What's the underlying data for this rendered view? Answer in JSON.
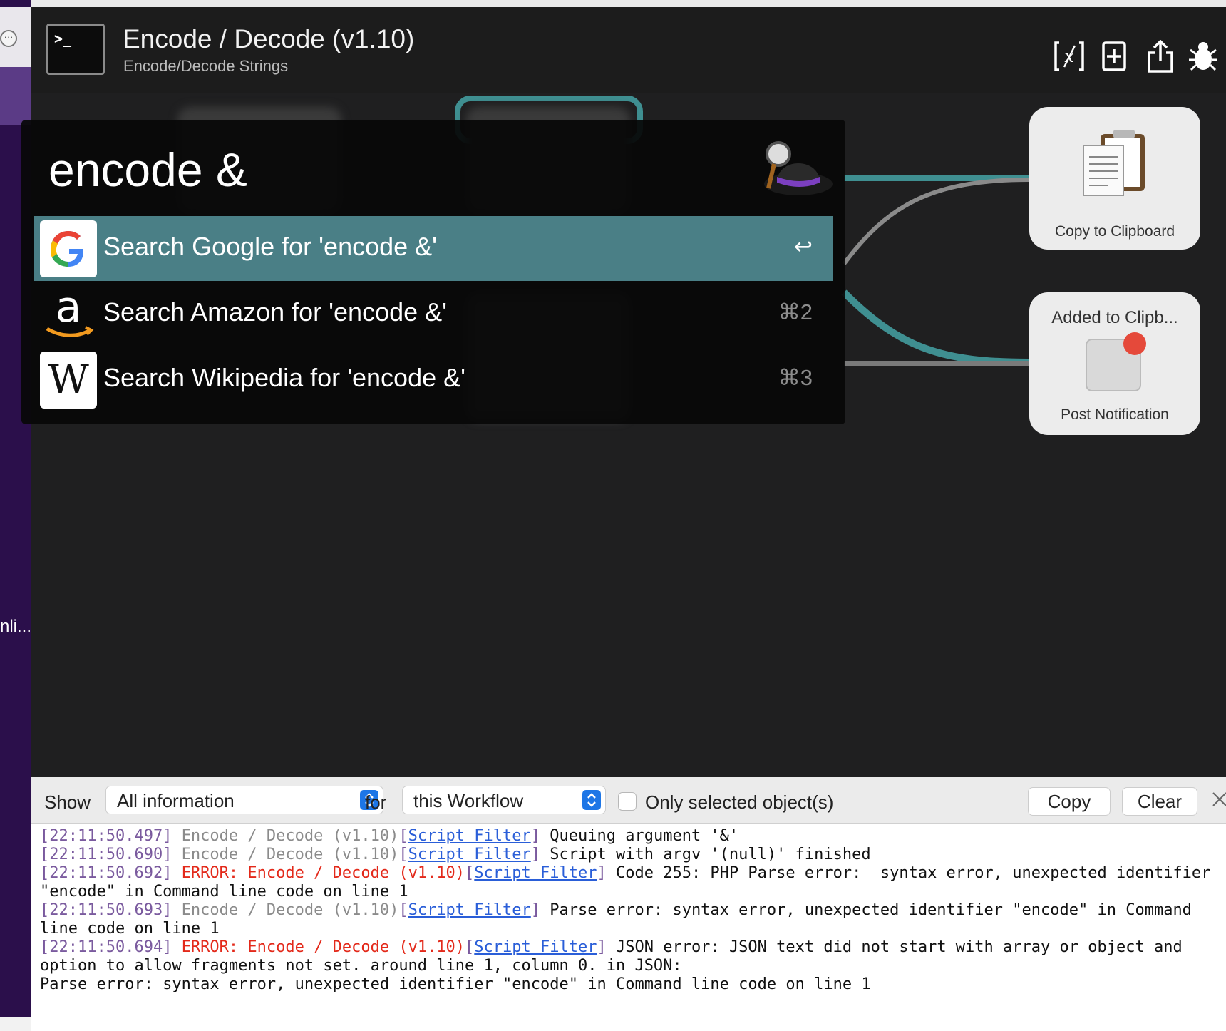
{
  "window": {
    "left_truncated_label": "nli...",
    "more_icon": "ellipsis-circle-icon"
  },
  "header": {
    "title": "Encode / Decode (v1.10)",
    "subtitle": "Encode/Decode Strings",
    "icons": [
      "variables-icon",
      "add-object-icon",
      "share-icon",
      "debug-bug-icon"
    ]
  },
  "canvas": {
    "nodes": {
      "copy_clipboard": {
        "label": "Copy to Clipboard",
        "icon": "clipboard-icon"
      },
      "post_notification": {
        "title": "Added to Clipb...",
        "label": "Post Notification",
        "icon": "notification-icon"
      }
    },
    "wire_color": "#3f8f91"
  },
  "alfred": {
    "query": "encode &",
    "results": [
      {
        "icon": "google-icon",
        "title": "Search Google for 'encode &'",
        "shortcut": "↩",
        "selected": true
      },
      {
        "icon": "amazon-icon",
        "title": "Search Amazon for 'encode &'",
        "shortcut": "⌘2",
        "selected": false
      },
      {
        "icon": "wikipedia-icon",
        "title": "Search Wikipedia for 'encode &'",
        "shortcut": "⌘3",
        "selected": false
      }
    ],
    "selected_color": "#4a7f86"
  },
  "debugger": {
    "show_label": "Show",
    "show_value": "All information",
    "for_label": "for",
    "for_value": "this Workflow",
    "only_selected_label": "Only selected object(s)",
    "copy_label": "Copy",
    "clear_label": "Clear",
    "log": [
      {
        "ts": "[22:11:50.497]",
        "source": "Encode / Decode (v1.10)",
        "error": false,
        "obj": "Script Filter",
        "msg": " Queuing argument '&'"
      },
      {
        "ts": "[22:11:50.690]",
        "source": "Encode / Decode (v1.10)",
        "error": false,
        "obj": "Script Filter",
        "msg": " Script with argv '(null)' finished"
      },
      {
        "ts": "[22:11:50.692]",
        "source": "ERROR: Encode / Decode (v1.10)",
        "error": true,
        "obj": "Script Filter",
        "msg": " Code 255: PHP Parse error:  syntax error, unexpected identifier \"encode\" in Command line code on line 1"
      },
      {
        "ts": "[22:11:50.693]",
        "source": "Encode / Decode (v1.10)",
        "error": false,
        "obj": "Script Filter",
        "msg": " Parse error: syntax error, unexpected identifier \"encode\" in Command line code on line 1"
      },
      {
        "ts": "[22:11:50.694]",
        "source": "ERROR: Encode / Decode (v1.10)",
        "error": true,
        "obj": "Script Filter",
        "msg": " JSON error: JSON text did not start with array or object and option to allow fragments not set. around line 1, column 0. in JSON:\nParse error: syntax error, unexpected identifier \"encode\" in Command line code on line 1"
      }
    ]
  }
}
